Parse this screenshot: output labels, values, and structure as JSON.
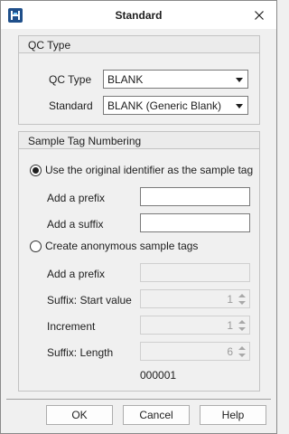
{
  "window": {
    "title": "Standard"
  },
  "qc_type_group": {
    "title": "QC Type",
    "qc_type_label": "QC Type",
    "qc_type_value": "BLANK",
    "standard_label": "Standard",
    "standard_value": "BLANK (Generic Blank)"
  },
  "sample_tag_group": {
    "title": "Sample Tag Numbering",
    "option_original": "Use the original identifier as the sample tag",
    "option_original_selected": true,
    "prefix_label": "Add a prefix",
    "prefix_value": "",
    "suffix_label": "Add a suffix",
    "suffix_value": "",
    "option_anonymous": "Create anonymous sample tags",
    "anon_prefix_label": "Add a prefix",
    "anon_prefix_value": "",
    "start_label": "Suffix: Start value",
    "start_value": "1",
    "increment_label": "Increment",
    "increment_value": "1",
    "length_label": "Suffix: Length",
    "length_value": "6",
    "preview": "000001"
  },
  "buttons": {
    "ok": "OK",
    "cancel": "Cancel",
    "help": "Help"
  }
}
